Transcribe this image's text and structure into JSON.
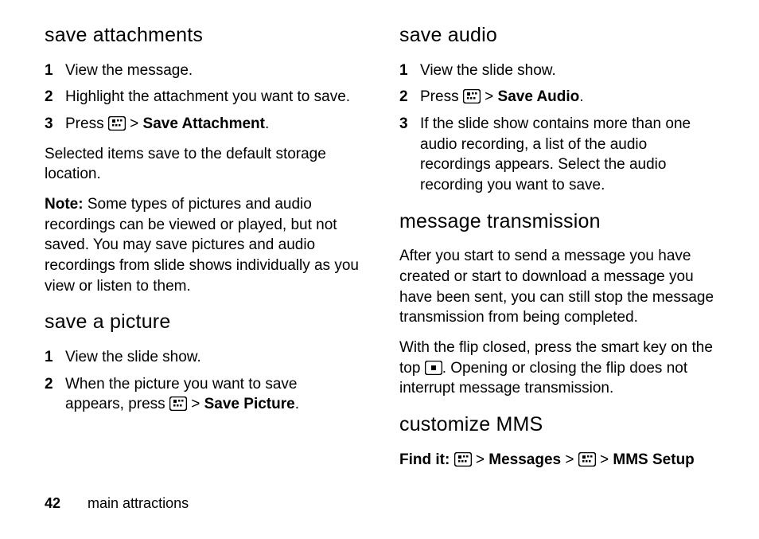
{
  "left": {
    "h1": "save attachments",
    "list1": {
      "i1": "View the message.",
      "i2": "Highlight the attachment you want to save.",
      "i3a": "Press ",
      "i3b": " > ",
      "i3c": "Save Attachment",
      "i3d": "."
    },
    "p1": "Selected items save to the default storage location.",
    "p2a": "Note:",
    "p2b": " Some types of pictures and audio recordings can be viewed or played, but not saved. You may save pictures and audio recordings from slide shows individually as you view or listen to them.",
    "h2": "save a picture",
    "list2": {
      "i1": "View the slide show.",
      "i2a": "When the picture you want to save appears, press ",
      "i2b": " > ",
      "i2c": "Save Picture",
      "i2d": "."
    }
  },
  "right": {
    "h1": "save audio",
    "list1": {
      "i1": "View the slide show.",
      "i2a": "Press ",
      "i2b": " > ",
      "i2c": "Save Audio",
      "i2d": ".",
      "i3": "If the slide show contains more than one audio recording, a list of the audio recordings appears. Select the audio recording you want to save."
    },
    "h2": "message transmission",
    "p1": "After you start to send a message you have created or start to download a message you have been sent, you can still stop the message transmission from being completed.",
    "p2a": "With the flip closed, press the smart key on the top ",
    "p2b": ". Opening or closing the flip does not interrupt message transmission.",
    "h3": "customize MMS",
    "find_a": "Find it:",
    "find_b": " > ",
    "find_c": "Messages",
    "find_d": " > ",
    "find_e": " > ",
    "find_f": "MMS Setup"
  },
  "footer": {
    "page": "42",
    "section": "main attractions"
  },
  "nums": {
    "n1": "1",
    "n2": "2",
    "n3": "3"
  }
}
